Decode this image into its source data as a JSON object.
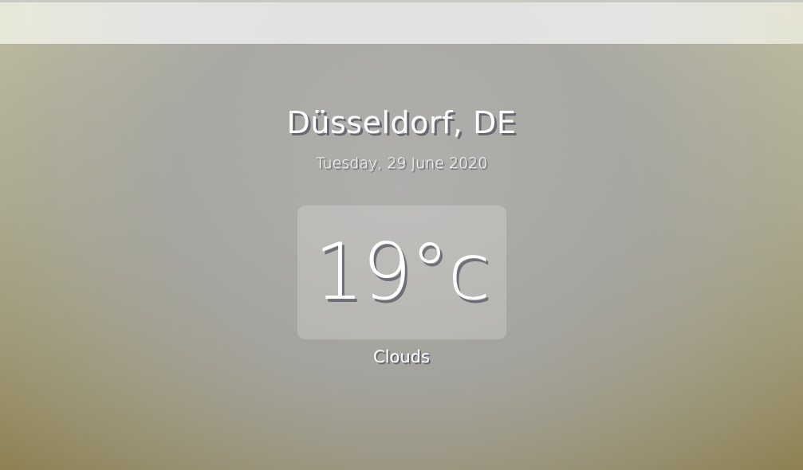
{
  "search": {
    "value": "",
    "placeholder": ""
  },
  "location": {
    "city_country": "Düsseldorf, DE",
    "date": "Tuesday, 29 June 2020"
  },
  "weather": {
    "temperature": "19°c",
    "condition": "Clouds"
  },
  "colors": {
    "text": "#ffffff",
    "panel": "#b3b3b3",
    "background_warm": "#8e8252"
  }
}
